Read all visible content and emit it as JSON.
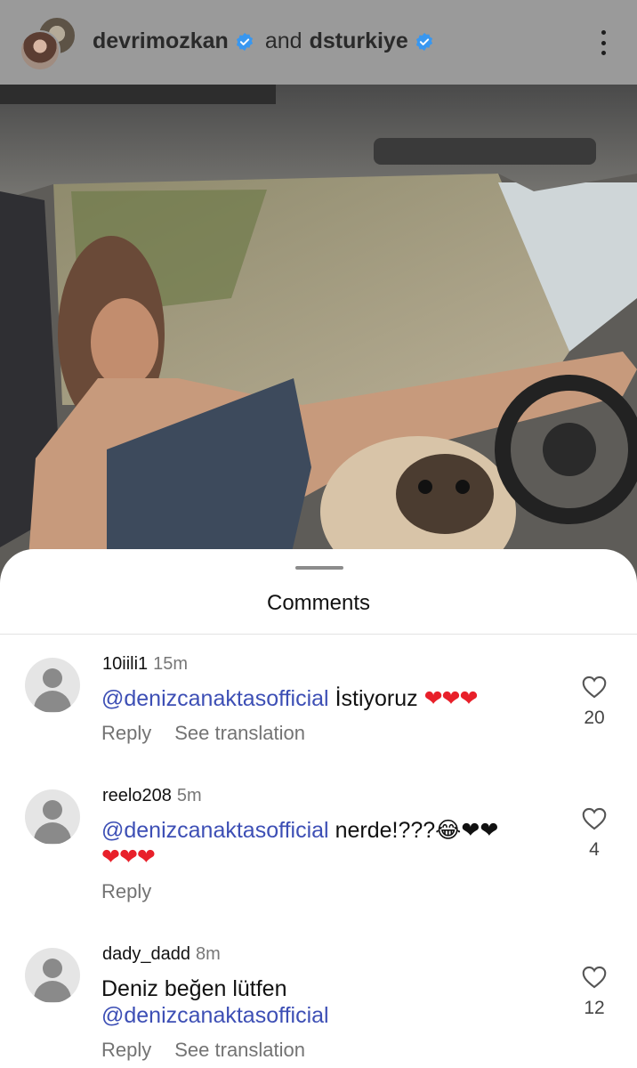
{
  "header": {
    "user1": "devrimozkan",
    "conjunction": "and",
    "user2": "dsturkiye",
    "verified_color": "#3897f0"
  },
  "sheet": {
    "title": "Comments"
  },
  "comments": [
    {
      "username": "10iili1",
      "time": "15m",
      "mention": "@denizcanaktasofficial",
      "text_after": " İstiyoruz ",
      "emoji": "❤❤❤",
      "reply_label": "Reply",
      "translate_label": "See translation",
      "likes": "20"
    },
    {
      "username": "reelo208",
      "time": "5m",
      "mention": "@denizcanaktasofficial",
      "text_after": " nerde!???😂❤❤",
      "emoji": "❤❤❤",
      "reply_label": "Reply",
      "likes": "4"
    },
    {
      "username": "dady_dadd",
      "time": "8m",
      "text_before": "Deniz beğen lütfen",
      "mention": "@denizcanaktasofficial",
      "reply_label": "Reply",
      "translate_label": "See translation",
      "likes": "12"
    }
  ],
  "icons": {
    "more": "more-vertical-icon",
    "like": "heart-icon",
    "verified": "verified-badge-icon"
  }
}
